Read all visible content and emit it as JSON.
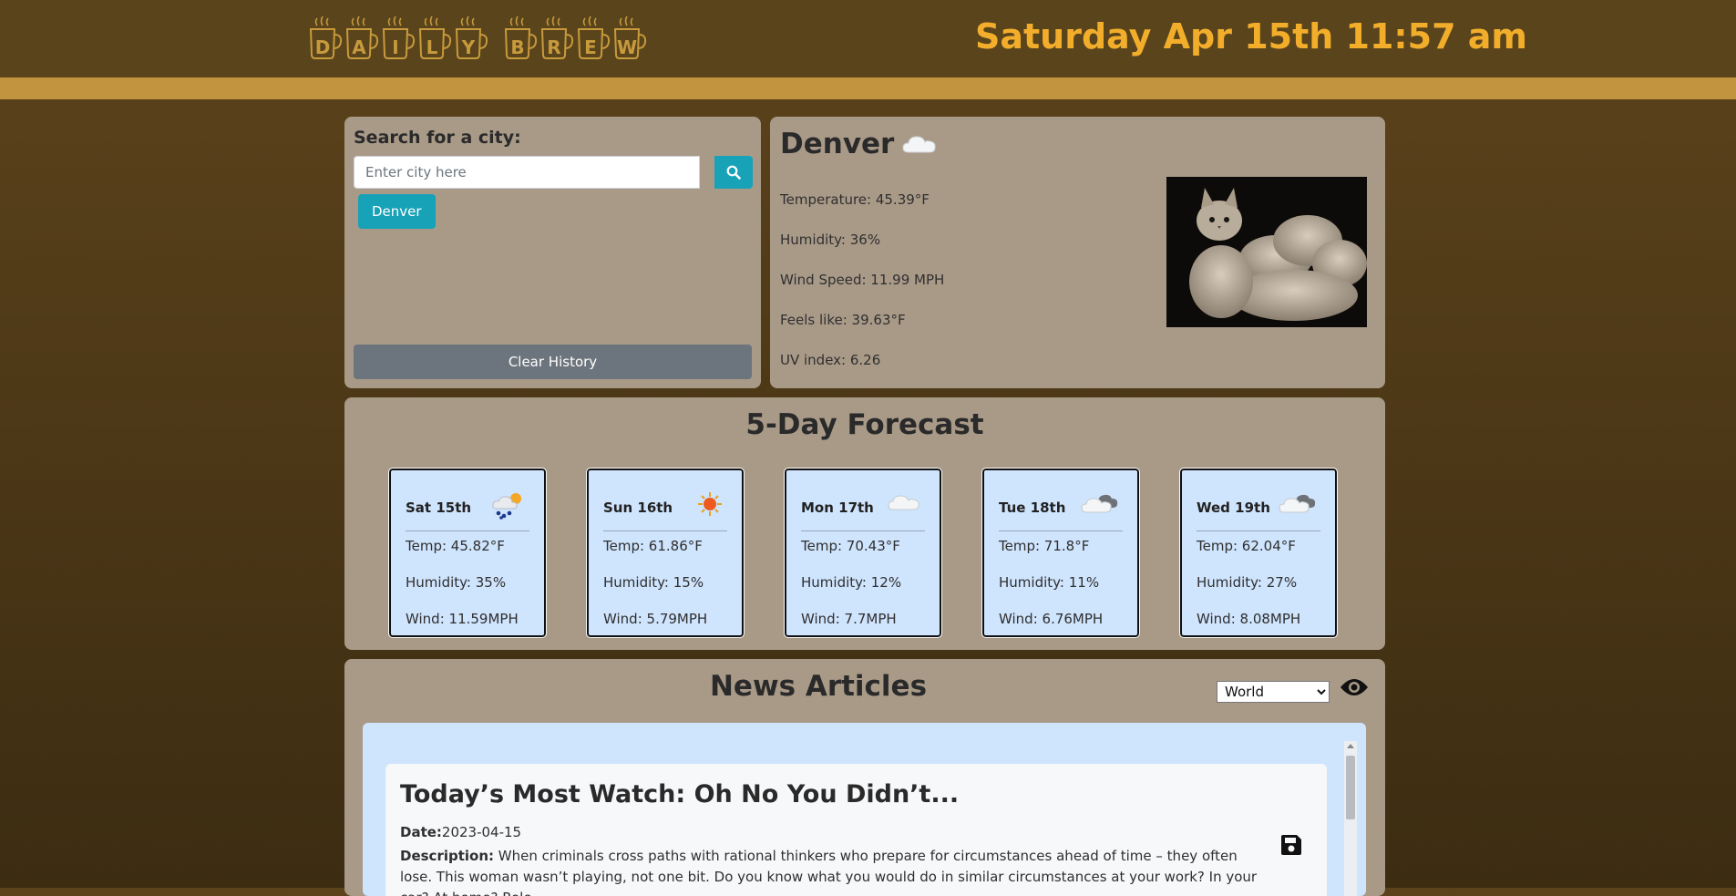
{
  "header": {
    "logo_letters": [
      "D",
      "A",
      "I",
      "L",
      "Y",
      "B",
      "R",
      "E",
      "W"
    ],
    "datetime": "Saturday Apr 15th 11:57 am"
  },
  "search": {
    "label": "Search for a city:",
    "placeholder": "Enter city here",
    "history": [
      "Denver"
    ],
    "clear_label": "Clear History"
  },
  "current": {
    "city": "Denver",
    "icon": "cloud-icon",
    "temperature": "Temperature: 45.39°F",
    "humidity": "Humidity: 36%",
    "wind": "Wind Speed: 11.99 MPH",
    "feels_like": "Feels like: 39.63°F",
    "uv": "UV index: 6.26"
  },
  "forecast": {
    "title": "5-Day Forecast",
    "days": [
      {
        "day": "Sat 15th",
        "icon": "rain-sun-icon",
        "temp": "Temp: 45.82°F",
        "humidity": "Humidity: 35%",
        "wind": "Wind: 11.59MPH"
      },
      {
        "day": "Sun 16th",
        "icon": "sun-icon",
        "temp": "Temp: 61.86°F",
        "humidity": "Humidity: 15%",
        "wind": "Wind: 5.79MPH"
      },
      {
        "day": "Mon 17th",
        "icon": "cloud-icon",
        "temp": "Temp: 70.43°F",
        "humidity": "Humidity: 12%",
        "wind": "Wind: 7.7MPH"
      },
      {
        "day": "Tue 18th",
        "icon": "clouds-icon",
        "temp": "Temp: 71.8°F",
        "humidity": "Humidity: 11%",
        "wind": "Wind: 6.76MPH"
      },
      {
        "day": "Wed 19th",
        "icon": "clouds-icon",
        "temp": "Temp: 62.04°F",
        "humidity": "Humidity: 27%",
        "wind": "Wind: 8.08MPH"
      }
    ]
  },
  "news": {
    "title": "News Articles",
    "category": "World",
    "article": {
      "title": "Today’s Most Watch: Oh No You Didn’t...",
      "date_label": "Date:",
      "date": "2023-04-15",
      "description_label": "Description:",
      "description": "When criminals cross paths with rational thinkers who prepare for circumstances ahead of time – they often lose. This woman wasn’t playing, not one bit. Do you know what you would do in similar circumstances at your work? In your car? At home? Role-"
    }
  },
  "colors": {
    "header_bg": "#5a441c",
    "stripe": "#c29440",
    "accent_text": "#f2ae2b",
    "panel": "#a99a88",
    "card": "#cfe4fd",
    "info_button": "#17a2b8",
    "secondary_button": "#6c757d"
  }
}
